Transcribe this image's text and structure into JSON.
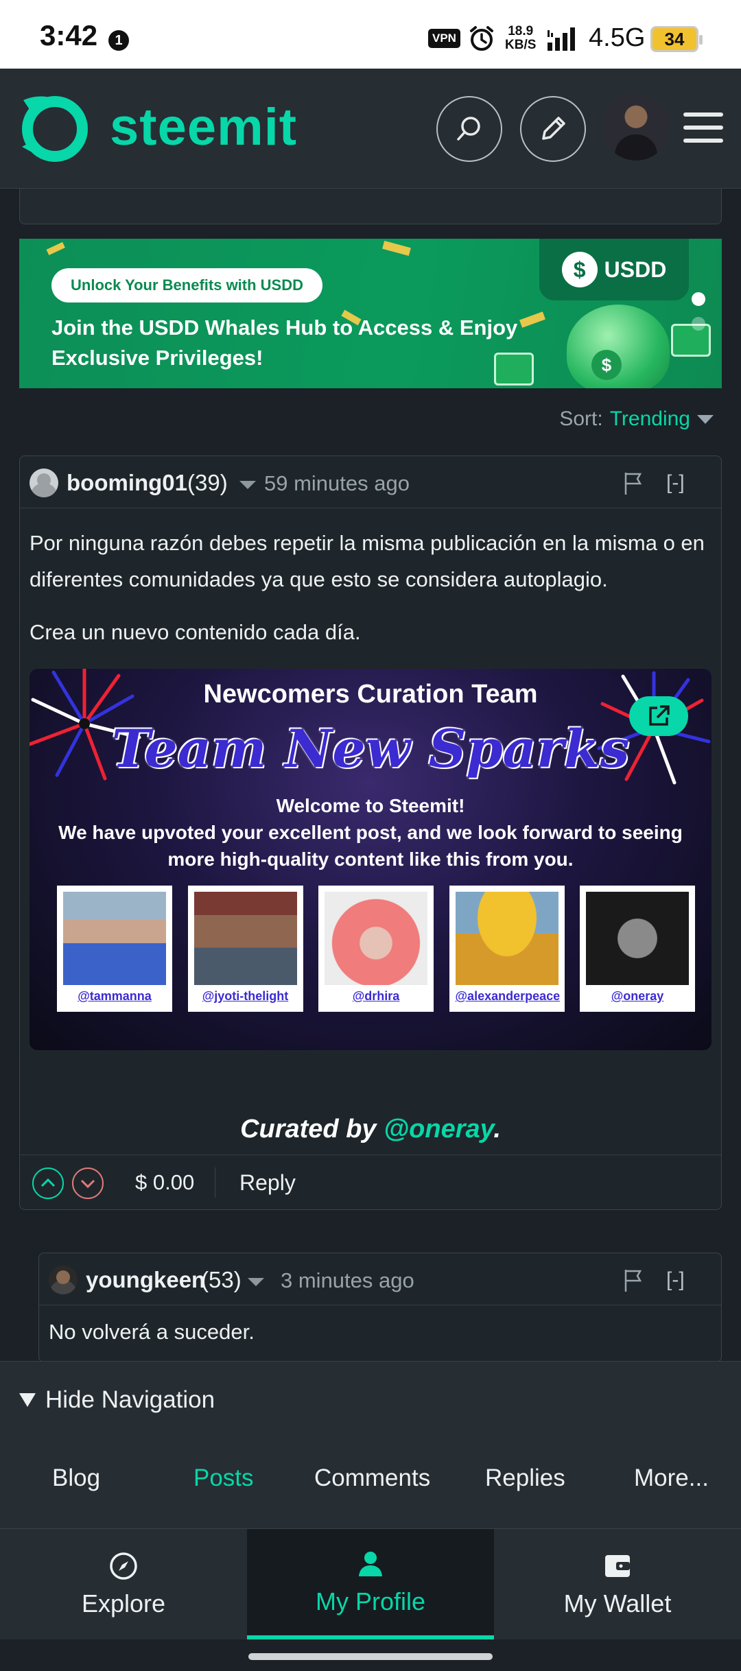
{
  "status_bar": {
    "time": "3:42",
    "notif_badge": "1",
    "vpn": "VPN",
    "speed_value": "18.9",
    "speed_unit": "KB/S",
    "network": "4.5G",
    "battery": "34"
  },
  "header": {
    "logo_text": "steemit",
    "icons": [
      "steemit-logo-icon",
      "search-icon",
      "pencil-icon",
      "avatar",
      "hamburger-menu-icon"
    ]
  },
  "banner": {
    "pill_text": "Unlock Your Benefits with USDD",
    "headline": "Join the USDD Whales Hub to Access & Enjoy Exclusive Privileges!",
    "brand": "USDD",
    "coin_symbol": "$"
  },
  "sort": {
    "label": "Sort:",
    "value": "Trending"
  },
  "comment": {
    "author": "booming01",
    "reputation": "(39)",
    "time": "59 minutes ago",
    "collapse": "[-]",
    "body": [
      "Por ninguna razón debes repetir la misma publicación en la misma o en diferentes comunidades ya que esto se considera autoplagio.",
      "Crea un nuevo contenido cada día."
    ],
    "promo": {
      "title": "Newcomers Curation Team",
      "script_title": "Team New Sparks",
      "line1": "Welcome to Steemit!",
      "line2": "We have upvoted your excellent post, and we look forward to seeing",
      "line3": "more high-quality content like this from you.",
      "members": [
        "@tammanna",
        "@jyoti-thelight",
        "@drhira",
        "@alexanderpeace",
        "@oneray"
      ]
    },
    "curated_prefix": "Curated by ",
    "curated_user": "@oneray",
    "curated_suffix": ".",
    "payout": "$ 0.00",
    "reply": "Reply"
  },
  "child_comment": {
    "author": "youngkeen",
    "reputation": "(53)",
    "time": "3 minutes ago",
    "collapse": "[-]",
    "body": "No volverá a suceder."
  },
  "sub_nav": {
    "toggle": "Hide Navigation",
    "tabs": [
      "Blog",
      "Posts",
      "Comments",
      "Replies",
      "More..."
    ],
    "active": "Posts"
  },
  "bottom_bar": {
    "items": [
      "Explore",
      "My Profile",
      "My Wallet"
    ],
    "active": "My Profile"
  },
  "colors": {
    "accent": "#07d7a9",
    "background": "#1b2126",
    "banner_green": "#0b9a5c"
  }
}
